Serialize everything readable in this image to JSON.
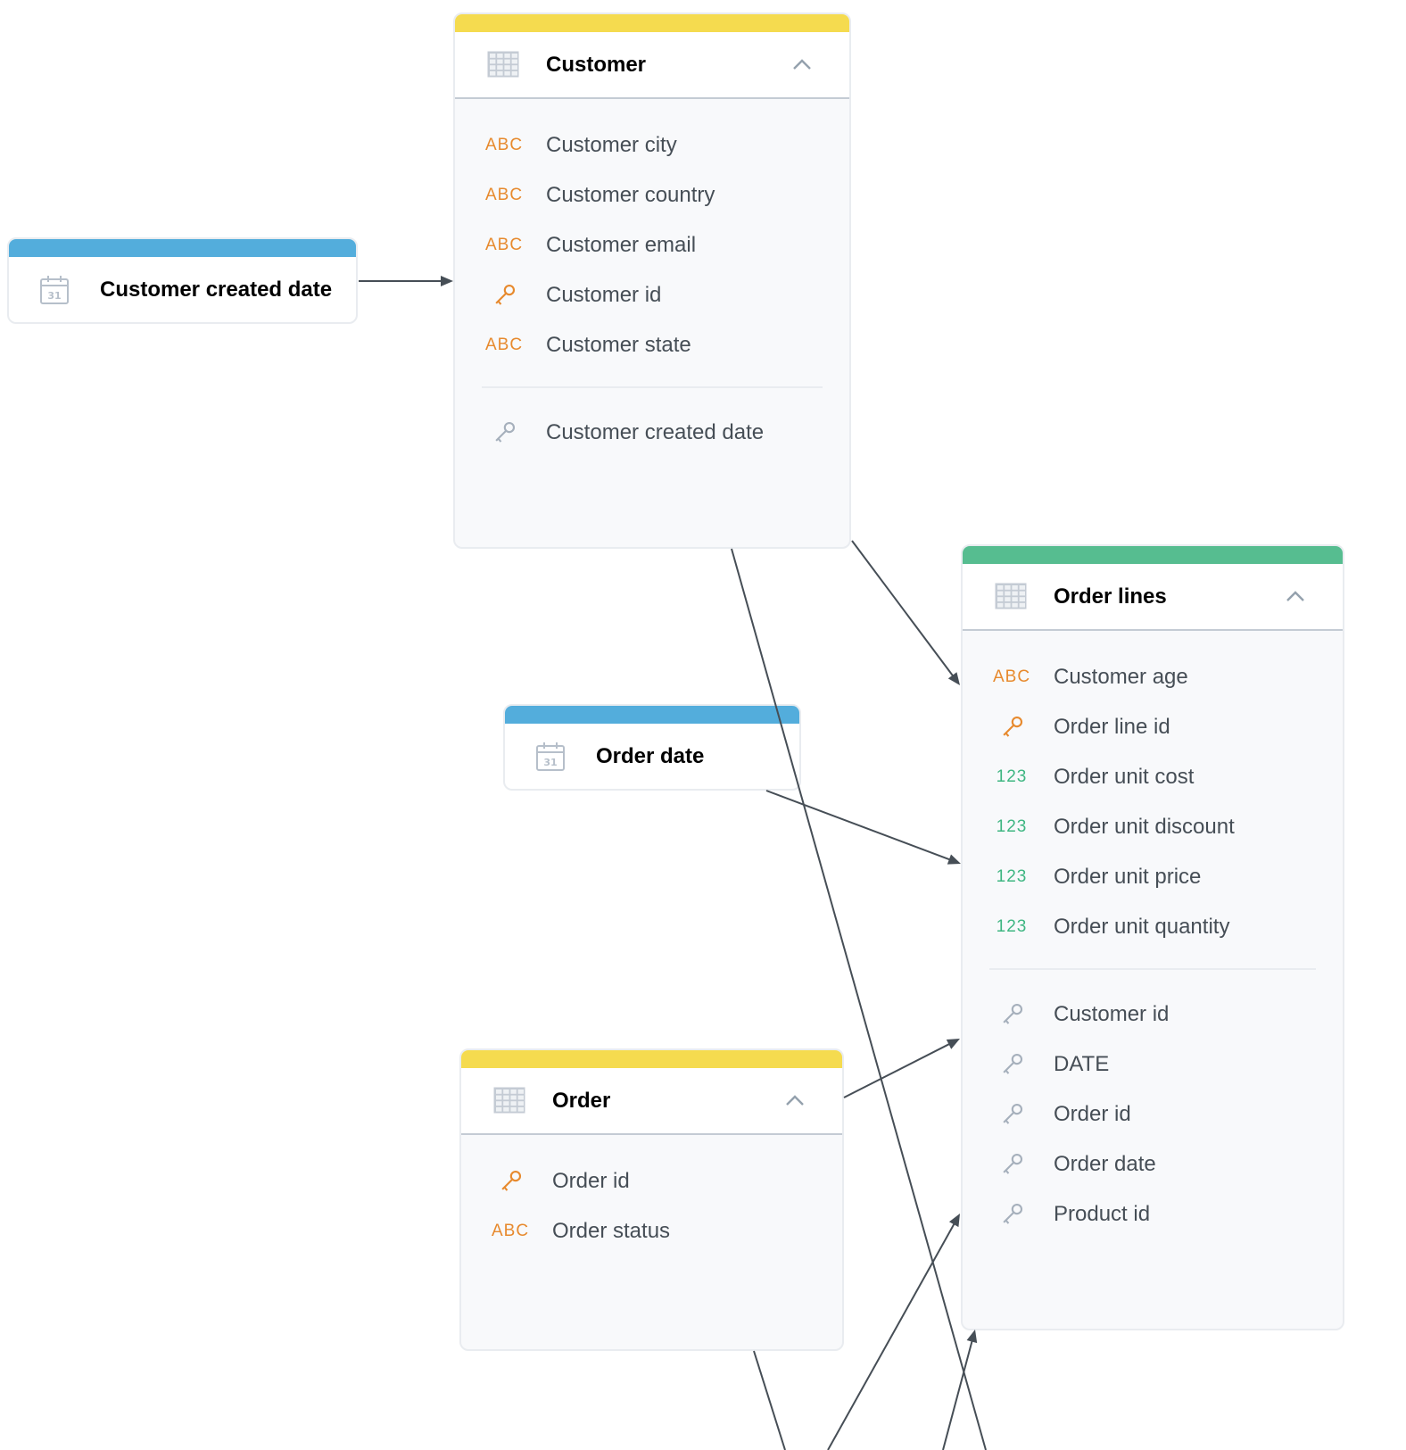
{
  "colors": {
    "dataset": "#f5db4f",
    "date": "#53addc",
    "fact": "#56bd90",
    "attribute_type": "#e78a2e",
    "fact_type": "#3eb682",
    "reference_key": "#a6b0bc",
    "edge": "#464e56"
  },
  "datasets": {
    "customer": {
      "title": "Customer",
      "fields": [
        {
          "type": "ABC",
          "label": "Customer city"
        },
        {
          "type": "ABC",
          "label": "Customer country"
        },
        {
          "type": "ABC",
          "label": "Customer email"
        },
        {
          "type": "key-icon",
          "label": "Customer id"
        },
        {
          "type": "ABC",
          "label": "Customer state"
        }
      ],
      "references": [
        {
          "type": "reference-key-icon",
          "label": "Customer created date"
        }
      ]
    },
    "order_lines": {
      "title": "Order lines",
      "fields": [
        {
          "type": "ABC",
          "label": "Customer age"
        },
        {
          "type": "key-icon",
          "label": "Order line id"
        },
        {
          "type": "123",
          "label": "Order unit cost"
        },
        {
          "type": "123",
          "label": "Order unit discount"
        },
        {
          "type": "123",
          "label": "Order unit price"
        },
        {
          "type": "123",
          "label": "Order unit quantity"
        }
      ],
      "references": [
        {
          "type": "reference-key-icon",
          "label": "Customer id"
        },
        {
          "type": "reference-key-icon",
          "label": "DATE"
        },
        {
          "type": "reference-key-icon",
          "label": "Order id"
        },
        {
          "type": "reference-key-icon",
          "label": "Order date"
        },
        {
          "type": "reference-key-icon",
          "label": "Product id"
        }
      ]
    },
    "order": {
      "title": "Order",
      "fields": [
        {
          "type": "key-icon",
          "label": "Order id"
        },
        {
          "type": "ABC",
          "label": "Order status"
        }
      ],
      "references": []
    }
  },
  "date_datasets": {
    "customer_created_date": {
      "title": "Customer created date",
      "icon": "calendar-icon"
    },
    "order_date": {
      "title": "Order date",
      "icon": "calendar-icon"
    }
  },
  "relationships": [
    {
      "from": "Customer created date",
      "to": "Customer"
    },
    {
      "from": "Customer",
      "to": "Order lines"
    },
    {
      "from": "Order date",
      "to": "Order lines"
    },
    {
      "from": "Order",
      "to": "Order lines"
    },
    {
      "from": "Customer",
      "to": "(offscreen below)"
    },
    {
      "from": "(offscreen below)",
      "to": "Order lines"
    },
    {
      "from": "Order",
      "to": "(offscreen below)"
    }
  ]
}
